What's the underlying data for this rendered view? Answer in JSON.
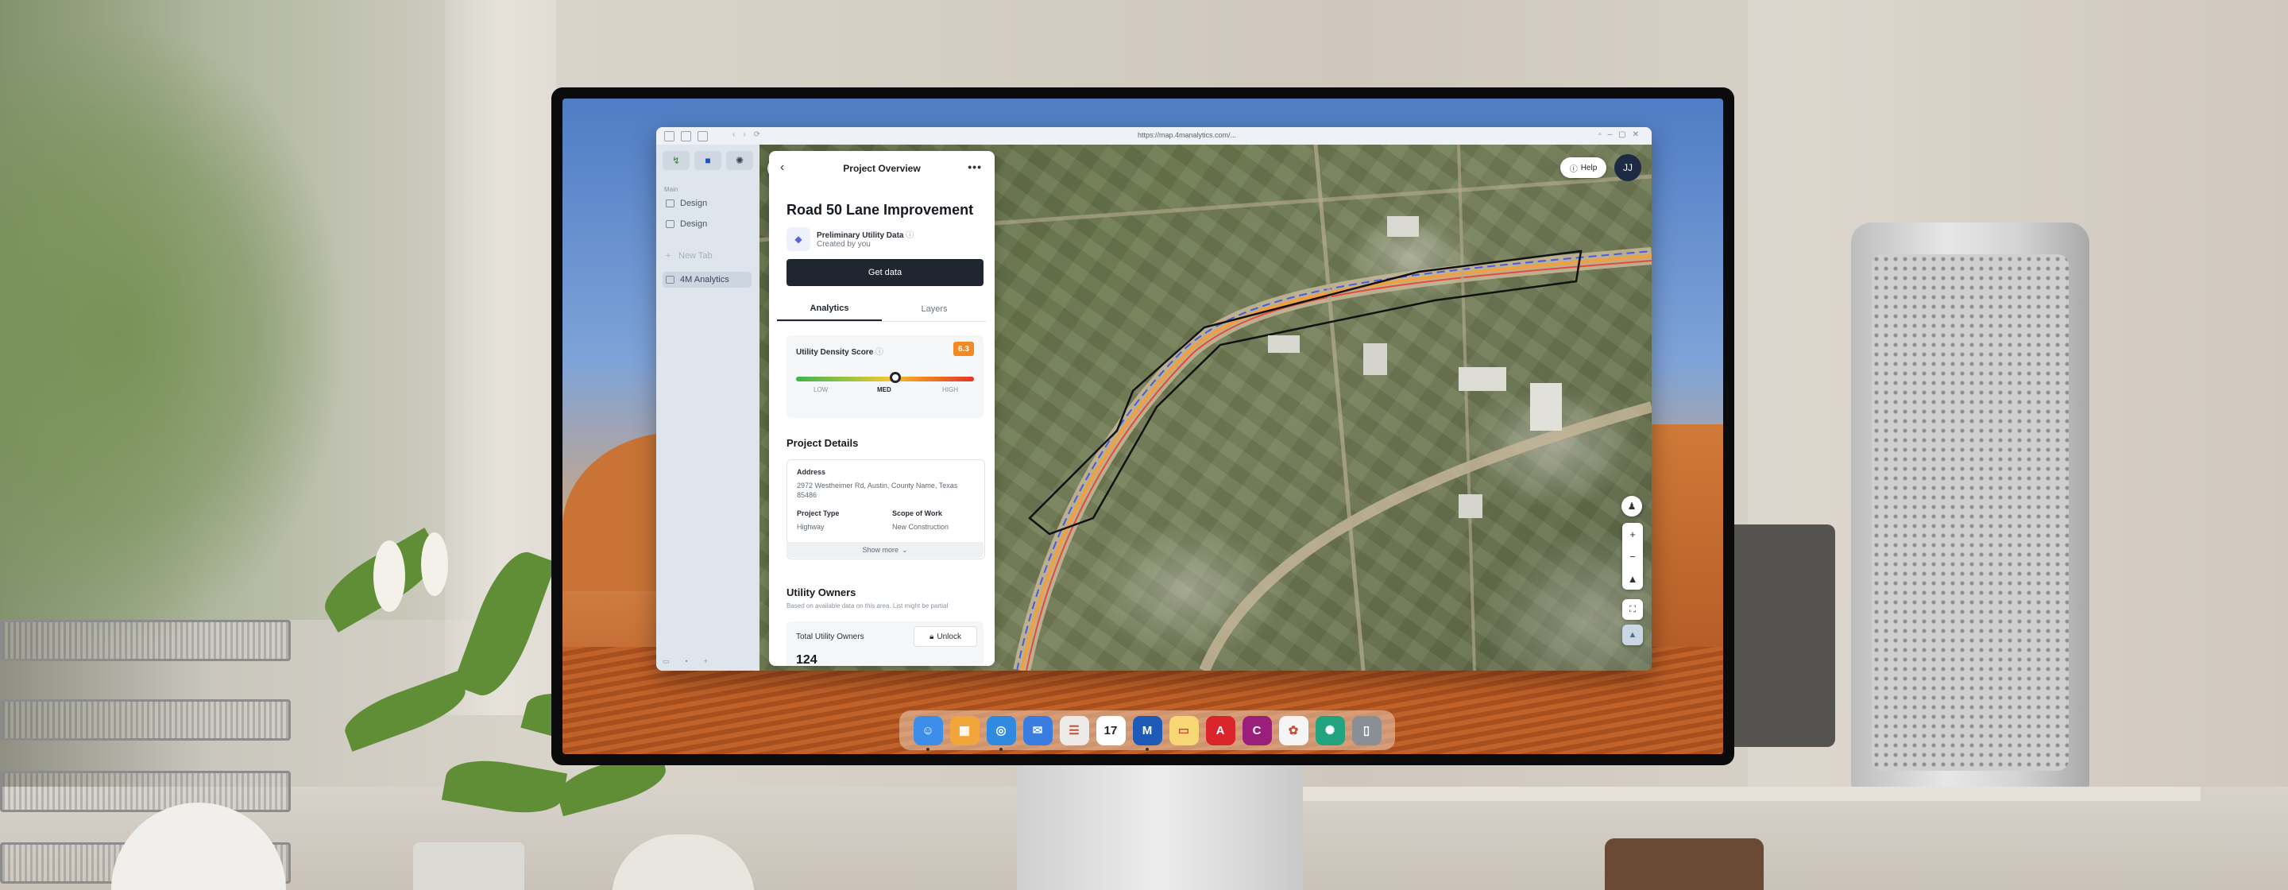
{
  "app": {
    "url": "https://map.4manalytics.com/...",
    "sidebar": {
      "section_label": "Main",
      "items": [
        {
          "label": "Design"
        },
        {
          "label": "Design"
        },
        {
          "label": "New Tab"
        },
        {
          "label": "4M Analytics"
        }
      ]
    },
    "panel": {
      "header_title": "Project Overview",
      "back_glyph": "‹",
      "more_glyph": "•••",
      "project_name": "Road 50 Lane Improvement",
      "data_title": "Preliminary Utility Data",
      "data_subtitle": "Created by you",
      "get_data_label": "Get data",
      "tabs": [
        {
          "label": "Analytics",
          "active": true
        },
        {
          "label": "Layers",
          "active": false
        }
      ],
      "score": {
        "label": "Utility Density Score",
        "value": "6.3",
        "level_fraction": 0.56,
        "ticks": [
          "LOW",
          "MED",
          "HIGH"
        ]
      },
      "details": {
        "section_title": "Project Details",
        "address_label": "Address",
        "address_value": "2972 Westheimer Rd, Austin, County Name, Texas 85486",
        "type_label": "Project Type",
        "type_value": "Highway",
        "scope_label": "Scope of Work",
        "scope_value": "New Construction",
        "show_more": "Show more"
      },
      "owners": {
        "section_title": "Utility Owners",
        "subtitle": "Based on available data on this area. List might be partial",
        "total_label": "Total Utility Owners",
        "unlock_label": "Unlock",
        "count": "124"
      }
    },
    "map_controls": {
      "help_label": "Help",
      "avatar_initials": "JJ"
    }
  },
  "icons": {
    "search": "search-icon",
    "help": "help-icon",
    "zoom_in": "plus-icon",
    "zoom_out": "minus-icon",
    "compass": "compass-icon",
    "fullscreen": "fullscreen-icon",
    "street_view": "person-icon",
    "lock": "lock-icon"
  },
  "dock": [
    {
      "name": "finder",
      "glyph": "☺",
      "color": "#3d8ee8"
    },
    {
      "name": "launchpad",
      "glyph": "▦",
      "color": "#f2a53a"
    },
    {
      "name": "safari",
      "glyph": "◎",
      "color": "#2f8ae0"
    },
    {
      "name": "mail",
      "glyph": "✉",
      "color": "#3a7de0"
    },
    {
      "name": "reminders",
      "glyph": "☰",
      "color": "#ecebe8"
    },
    {
      "name": "calendar",
      "glyph": "17",
      "color": "#ffffff"
    },
    {
      "name": "app-m",
      "glyph": "M",
      "color": "#1e5bb8"
    },
    {
      "name": "notes",
      "glyph": "▭",
      "color": "#f7d774"
    },
    {
      "name": "acrobat",
      "glyph": "A",
      "color": "#d9252b"
    },
    {
      "name": "app-c",
      "glyph": "C",
      "color": "#9b1f7a"
    },
    {
      "name": "photos",
      "glyph": "✿",
      "color": "#f5f5f5"
    },
    {
      "name": "chatgpt",
      "glyph": "✺",
      "color": "#21a37f"
    },
    {
      "name": "trash",
      "glyph": "▯",
      "color": "#8a8f96"
    }
  ],
  "colors": {
    "panel_button": "#1f2630",
    "score_badge": "#f08a24",
    "route_outline": "#111111"
  }
}
